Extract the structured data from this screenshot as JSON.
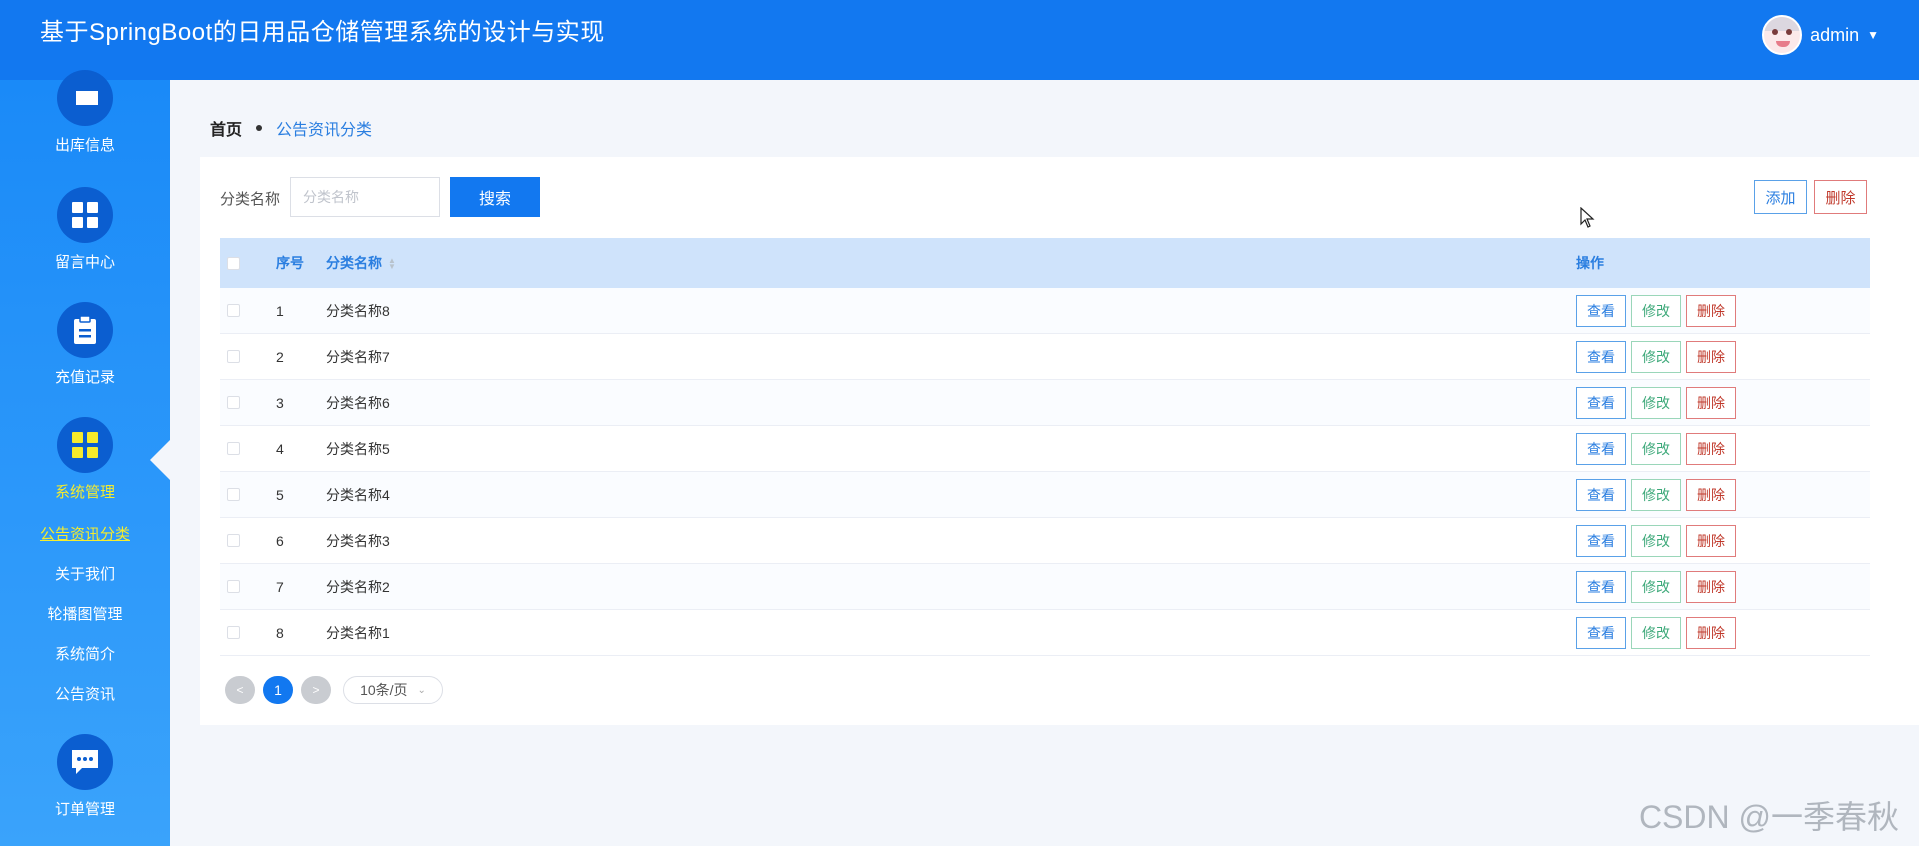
{
  "header": {
    "title": "基于SpringBoot的日用品仓储管理系统的设计与实现",
    "username": "admin"
  },
  "sidebar": {
    "items": [
      {
        "label": "出库信息",
        "icon": "document-icon"
      },
      {
        "label": "留言中心",
        "icon": "grid-icon"
      },
      {
        "label": "充值记录",
        "icon": "clipboard-icon"
      },
      {
        "label": "系统管理",
        "icon": "grid-icon",
        "active": true
      },
      {
        "label": "订单管理",
        "icon": "chat-icon"
      }
    ],
    "subitems": [
      "公告资讯分类",
      "关于我们",
      "轮播图管理",
      "系统简介",
      "公告资讯"
    ]
  },
  "breadcrumb": {
    "home": "首页",
    "current": "公告资讯分类"
  },
  "search": {
    "label": "分类名称",
    "placeholder": "分类名称",
    "button": "搜索"
  },
  "actions": {
    "add": "添加",
    "delete": "删除"
  },
  "table": {
    "headers": {
      "index": "序号",
      "name": "分类名称",
      "ops": "操作"
    },
    "rows": [
      {
        "index": "1",
        "name": "分类名称8"
      },
      {
        "index": "2",
        "name": "分类名称7"
      },
      {
        "index": "3",
        "name": "分类名称6"
      },
      {
        "index": "4",
        "name": "分类名称5"
      },
      {
        "index": "5",
        "name": "分类名称4"
      },
      {
        "index": "6",
        "name": "分类名称3"
      },
      {
        "index": "7",
        "name": "分类名称2"
      },
      {
        "index": "8",
        "name": "分类名称1"
      }
    ],
    "op_labels": {
      "view": "查看",
      "edit": "修改",
      "delete": "删除"
    }
  },
  "pagination": {
    "prev": "<",
    "current": "1",
    "next": ">",
    "page_size": "10条/页"
  },
  "watermark": "CSDN @一季春秋",
  "colors": {
    "header_bg": "#1278f0",
    "active_menu": "#f6ec2c",
    "table_header_bg": "#cfe3fb"
  }
}
